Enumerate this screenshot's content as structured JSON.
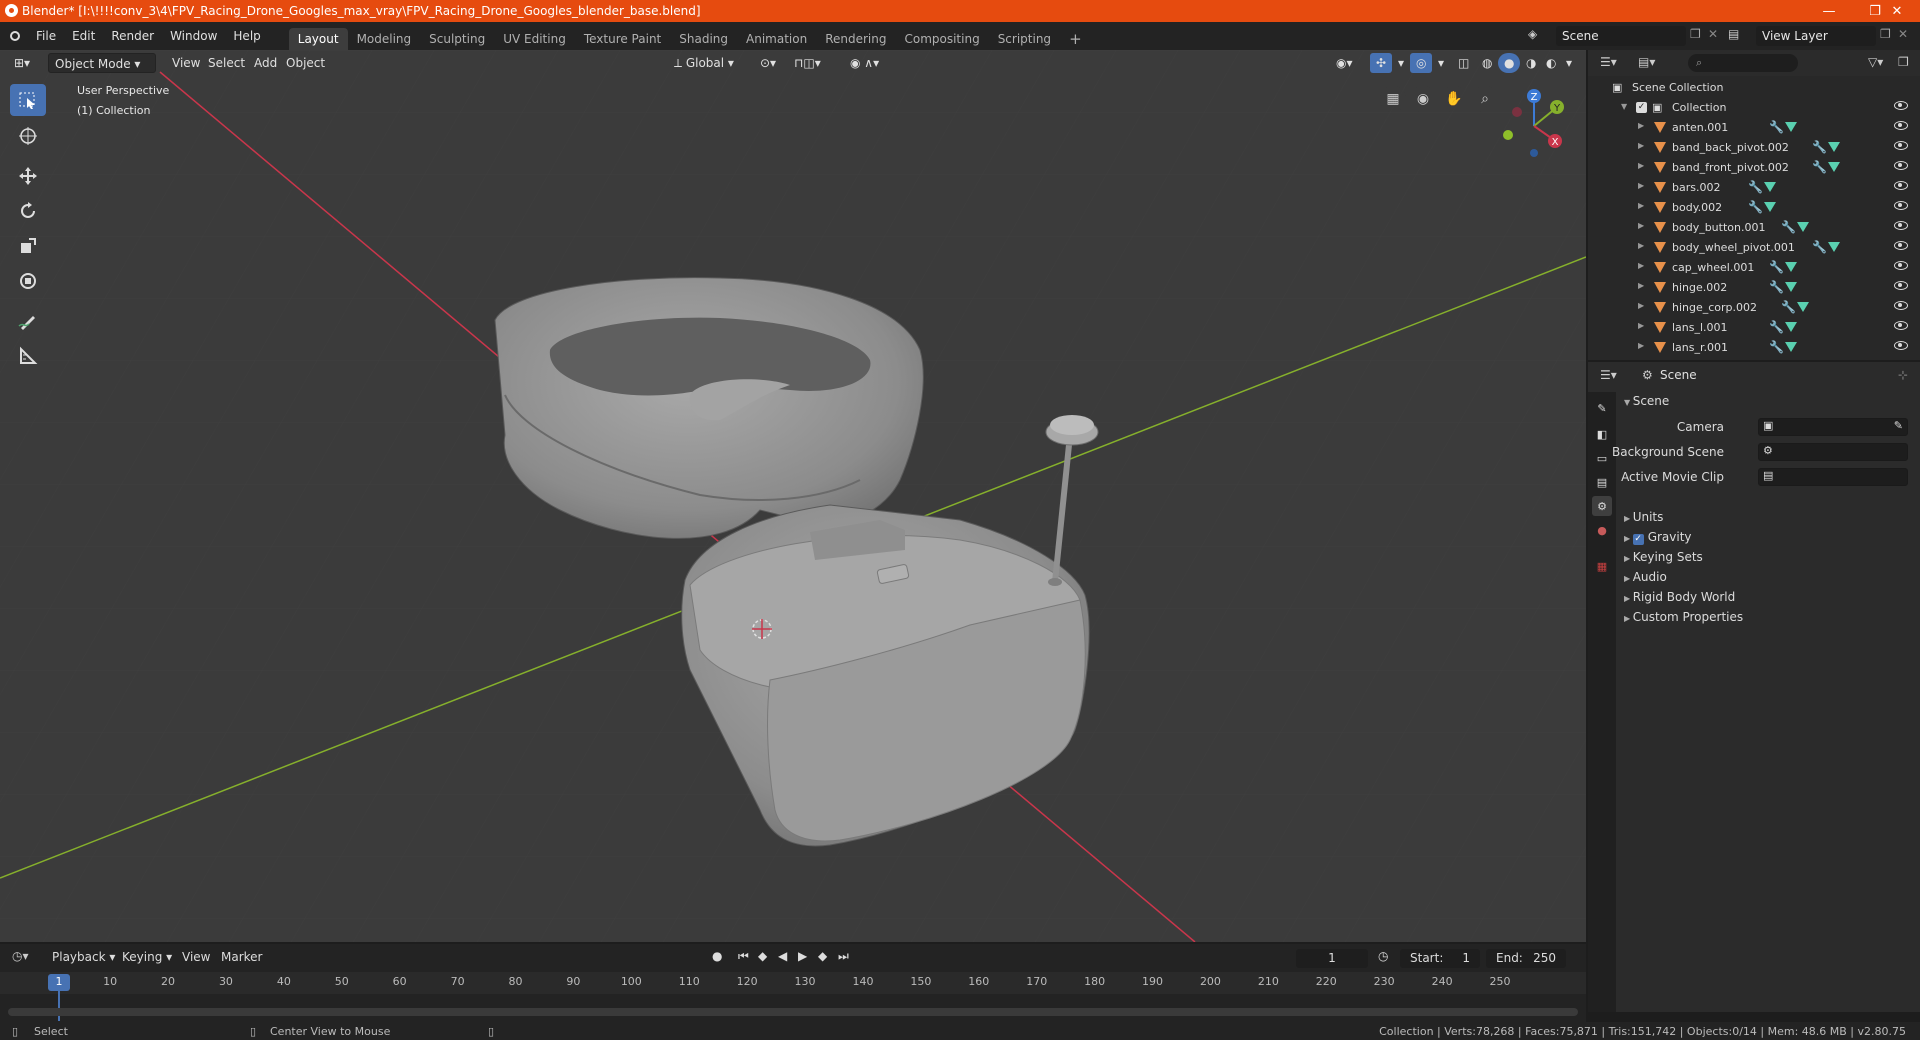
{
  "window": {
    "title": "Blender* [I:\\!!!!conv_3\\4\\FPV_Racing_Drone_Googles_max_vray\\FPV_Racing_Drone_Googles_blender_base.blend]",
    "minimize": "—",
    "maximize": "❐",
    "close": "✕"
  },
  "menu": {
    "items": [
      "File",
      "Edit",
      "Render",
      "Window",
      "Help"
    ],
    "workspaces": [
      "Layout",
      "Modeling",
      "Sculpting",
      "UV Editing",
      "Texture Paint",
      "Shading",
      "Animation",
      "Rendering",
      "Compositing",
      "Scripting"
    ],
    "add_tab": "+",
    "scene": "Scene",
    "view_layer": "View Layer"
  },
  "viewport": {
    "mode": "Object Mode",
    "menus": [
      "View",
      "Select",
      "Add",
      "Object"
    ],
    "orientation": "Global",
    "perspective_label": "User Perspective",
    "collection_label": "(1) Collection",
    "gizmo_axes": [
      "X",
      "Y",
      "Z"
    ]
  },
  "outliner": {
    "root": "Scene Collection",
    "collection": "Collection",
    "objects": [
      "anten.001",
      "band_back_pivot.002",
      "band_front_pivot.002",
      "bars.002",
      "body.002",
      "body_button.001",
      "body_wheel_pivot.001",
      "cap_wheel.001",
      "hinge.002",
      "hinge_corp.002",
      "lans_l.001",
      "lans_r.001"
    ]
  },
  "properties": {
    "header": "Scene",
    "panel_title": "Scene",
    "camera_label": "Camera",
    "background_scene_label": "Background Scene",
    "active_movie_clip_label": "Active Movie Clip",
    "sections": [
      "Units",
      "Gravity",
      "Keying Sets",
      "Audio",
      "Rigid Body World",
      "Custom Properties"
    ]
  },
  "timeline": {
    "menus": [
      "Playback",
      "Keying",
      "View",
      "Marker"
    ],
    "current_frame": "1",
    "start_label": "Start:",
    "start_value": "1",
    "end_label": "End:",
    "end_value": "250",
    "ticks": [
      "1",
      "10",
      "20",
      "30",
      "40",
      "50",
      "60",
      "70",
      "80",
      "90",
      "100",
      "110",
      "120",
      "130",
      "140",
      "150",
      "160",
      "170",
      "180",
      "190",
      "200",
      "210",
      "220",
      "230",
      "240",
      "250"
    ]
  },
  "status": {
    "left_action": "Select",
    "middle_action": "Center View to Mouse",
    "stats": "Collection | Verts:78,268 | Faces:75,871 | Tris:151,742 | Objects:0/14 | Mem: 48.6 MB | v2.80.75"
  },
  "colors": {
    "title_bar": "#e64b0f",
    "accent": "#4772b3",
    "x_axis": "#c9364b",
    "y_axis": "#86b02c",
    "z_axis": "#3d7bd6"
  }
}
